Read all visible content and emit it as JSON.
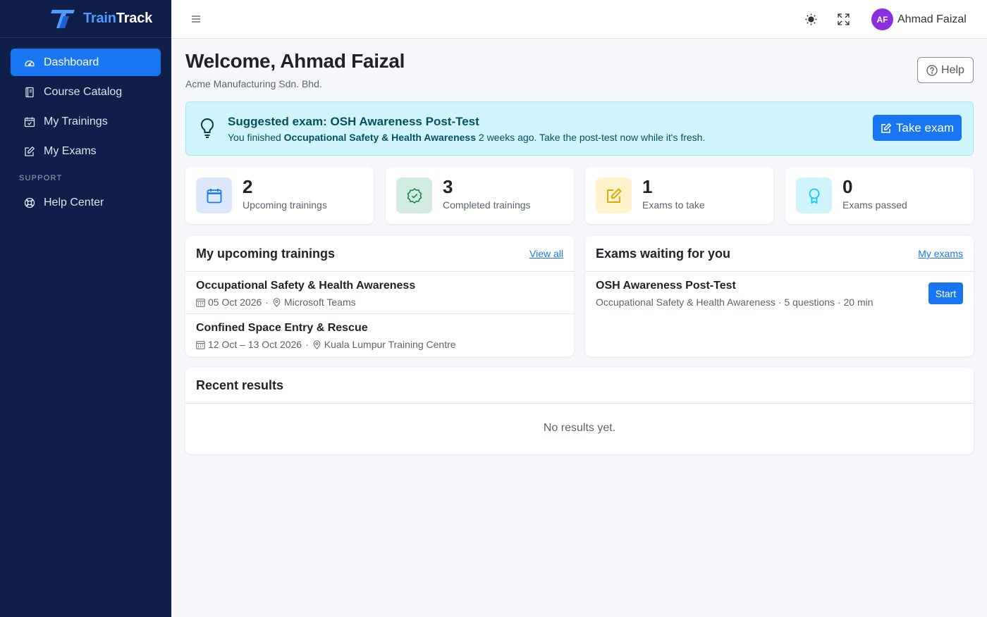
{
  "brand": {
    "part1": "Train",
    "part2": "Track",
    "accent": "#4d9bff"
  },
  "sidebar": {
    "items": [
      {
        "label": "Dashboard",
        "icon": "dashboard-gauge-icon",
        "active": true
      },
      {
        "label": "Course Catalog",
        "icon": "book-icon",
        "active": false
      },
      {
        "label": "My Trainings",
        "icon": "calendar-check-icon",
        "active": false
      },
      {
        "label": "My Exams",
        "icon": "pencil-square-icon",
        "active": false
      }
    ],
    "section": "SUPPORT",
    "support_items": [
      {
        "label": "Help Center",
        "icon": "lifebuoy-icon"
      }
    ]
  },
  "topbar": {
    "menu_icon": "hamburger-icon",
    "theme_icon": "sun-icon",
    "fullscreen_icon": "fullscreen-icon",
    "user": {
      "initials": "AF",
      "name": "Ahmad Faizal",
      "avatar_color": "#8b2ee0"
    }
  },
  "page": {
    "title": "Welcome, Ahmad Faizal",
    "company": "Acme Manufacturing Sdn. Bhd.",
    "help_label": "Help"
  },
  "suggestion": {
    "title": "Suggested exam: OSH Awareness Post-Test",
    "prefix": "You finished ",
    "course": "Occupational Safety & Health Awareness",
    "suffix": " 2 weeks ago. Take the post-test now while it's fresh.",
    "button": "Take exam"
  },
  "stats": [
    {
      "value": "2",
      "label": "Upcoming trainings",
      "icon": "calendar-icon",
      "bg": "#dbe8fd",
      "color": "#1976f3"
    },
    {
      "value": "3",
      "label": "Completed trainings",
      "icon": "badge-check-icon",
      "bg": "#d3ece1",
      "color": "#198754"
    },
    {
      "value": "1",
      "label": "Exams to take",
      "icon": "pencil-square-icon",
      "bg": "#fff2cc",
      "color": "#e0a800"
    },
    {
      "value": "0",
      "label": "Exams passed",
      "icon": "award-icon",
      "bg": "#cff4fc",
      "color": "#0dcaf0"
    }
  ],
  "upcoming": {
    "title": "My upcoming trainings",
    "link": "View all",
    "items": [
      {
        "title": "Occupational Safety & Health Awareness",
        "date": "05 Oct 2026",
        "location": "Microsoft Teams"
      },
      {
        "title": "Confined Space Entry & Rescue",
        "date": "12 Oct – 13 Oct 2026",
        "location": "Kuala Lumpur Training Centre"
      }
    ]
  },
  "exams": {
    "title": "Exams waiting for you",
    "link": "My exams",
    "items": [
      {
        "title": "OSH Awareness Post-Test",
        "meta": "Occupational Safety & Health Awareness · 5 questions · 20 min",
        "button": "Start"
      }
    ]
  },
  "results": {
    "title": "Recent results",
    "empty": "No results yet."
  }
}
